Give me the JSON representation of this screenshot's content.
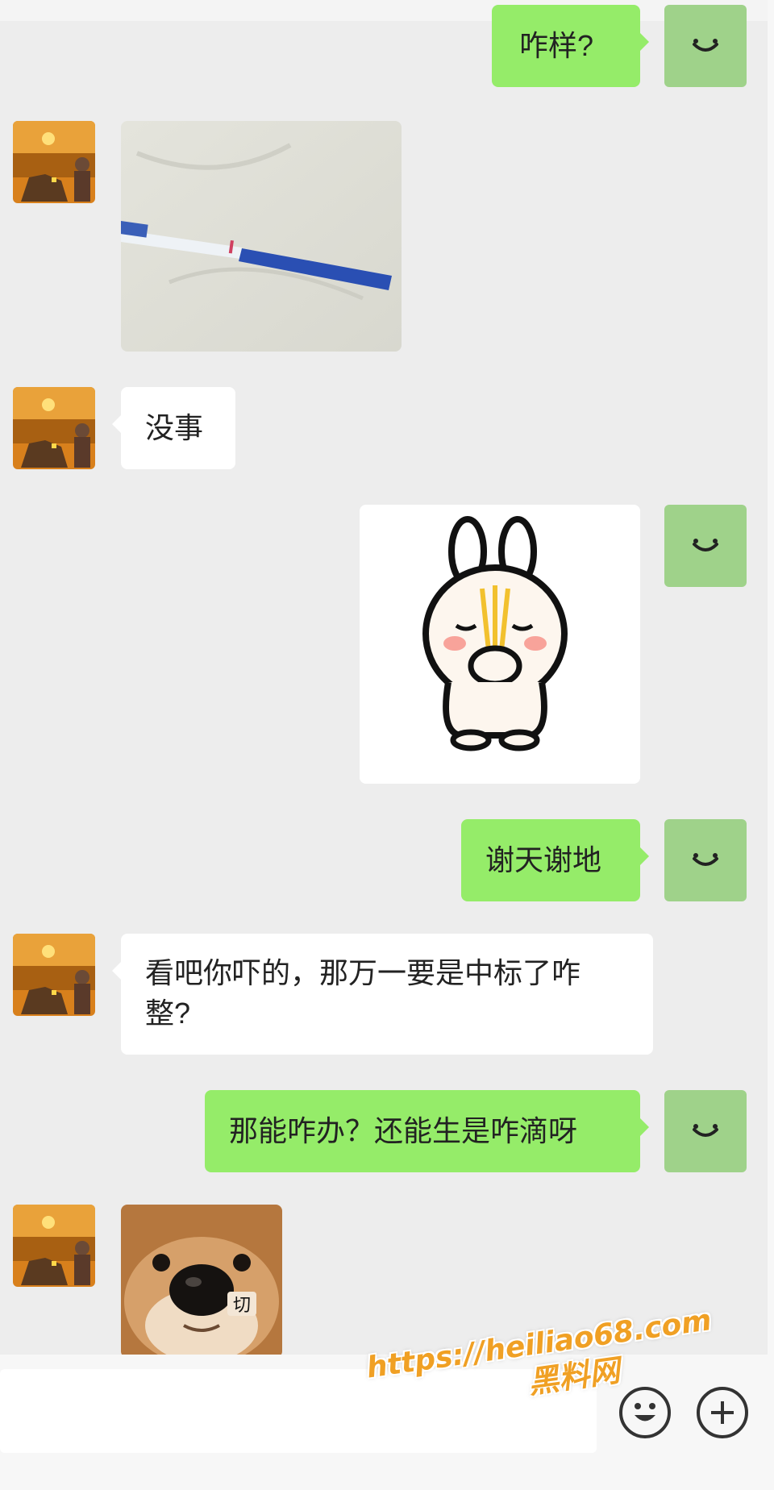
{
  "colors": {
    "self_bubble": "#95ec69",
    "peer_bubble": "#ffffff",
    "self_avatar": "#9fd28a",
    "background": "#ededed",
    "watermark": "#f0a024"
  },
  "messages": [
    {
      "from": "self",
      "type": "text",
      "text": "咋样?"
    },
    {
      "from": "peer",
      "type": "image",
      "icon": "test-strip-photo"
    },
    {
      "from": "peer",
      "type": "text",
      "text": "没事"
    },
    {
      "from": "self",
      "type": "sticker",
      "icon": "rabbit-praying-sticker"
    },
    {
      "from": "self",
      "type": "text",
      "text": "谢天谢地"
    },
    {
      "from": "peer",
      "type": "text",
      "line1": "看吧你吓的，那万一要是中标了咋",
      "line2": "整?"
    },
    {
      "from": "self",
      "type": "text",
      "text": "那能咋办？还能生是咋滴呀"
    },
    {
      "from": "peer",
      "type": "sticker",
      "icon": "shiba-dog-sticker",
      "caption": "切"
    }
  ],
  "toolbar": {
    "emoji_icon": "smiley-icon",
    "more_icon": "plus-circle-icon"
  },
  "watermark": {
    "url": "https://heiliao68.com",
    "name": "黑料网"
  }
}
